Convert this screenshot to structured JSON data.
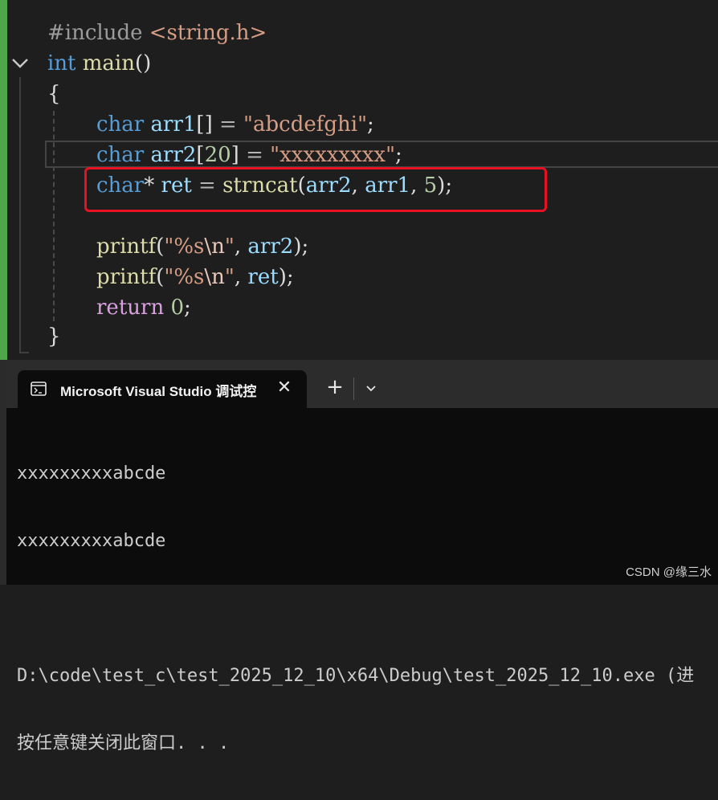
{
  "editor": {
    "line_include": {
      "directive": "#include",
      "header": "<string.h>"
    },
    "line_main": {
      "type": "int",
      "name": "main",
      "parens": "()"
    },
    "open_brace": "{",
    "line_arr1": {
      "type": "char",
      "var": "arr1",
      "brackets": "[]",
      "eq": " = ",
      "value": "\"abcdefghi\"",
      "semi": ";"
    },
    "line_arr2": {
      "type": "char",
      "var": "arr2",
      "size_open": "[",
      "size": "20",
      "size_close": "]",
      "eq": " = ",
      "value": "\"xxxxxxxxx\"",
      "semi": ";"
    },
    "line_ret": {
      "type": "char",
      "star": "*",
      "var": "ret",
      "eq": " = ",
      "fn": "strncat",
      "p_open": "(",
      "arg1": "arr2",
      "comma1": ", ",
      "arg2": "arr1",
      "comma2": ", ",
      "arg3": "5",
      "p_close": ")",
      "semi": ";"
    },
    "line_printf1": {
      "fn": "printf",
      "p_open": "(",
      "q1": "\"",
      "fmt": "%s",
      "esc": "\\n",
      "q2": "\"",
      "comma": ", ",
      "arg": "arr2",
      "p_close": ")",
      "semi": ";"
    },
    "line_printf2": {
      "fn": "printf",
      "p_open": "(",
      "q1": "\"",
      "fmt": "%s",
      "esc": "\\n",
      "q2": "\"",
      "comma": ", ",
      "arg": "ret",
      "p_close": ")",
      "semi": ";"
    },
    "line_return": {
      "kw": "return",
      "value": "0",
      "semi": ";"
    },
    "close_brace": "}"
  },
  "terminal": {
    "tab_title": "Microsoft Visual Studio 调试控",
    "tab_icon": "console-icon",
    "new_tab_label": "+",
    "close_label": "✕",
    "output": [
      "xxxxxxxxxabcde",
      "xxxxxxxxxabcde",
      "",
      "D:\\code\\test_c\\test_2025_12_10\\x64\\Debug\\test_2025_12_10.exe (进",
      "按任意键关闭此窗口. . ."
    ]
  },
  "watermark": "CSDN @缘三水",
  "colors": {
    "highlight_box": "#e81123",
    "change_bar": "#4ea84a",
    "keyword": "#569cd6",
    "function": "#dcdcaa",
    "variable": "#9cdcfe",
    "string": "#d69d85",
    "number": "#b5cea8"
  }
}
